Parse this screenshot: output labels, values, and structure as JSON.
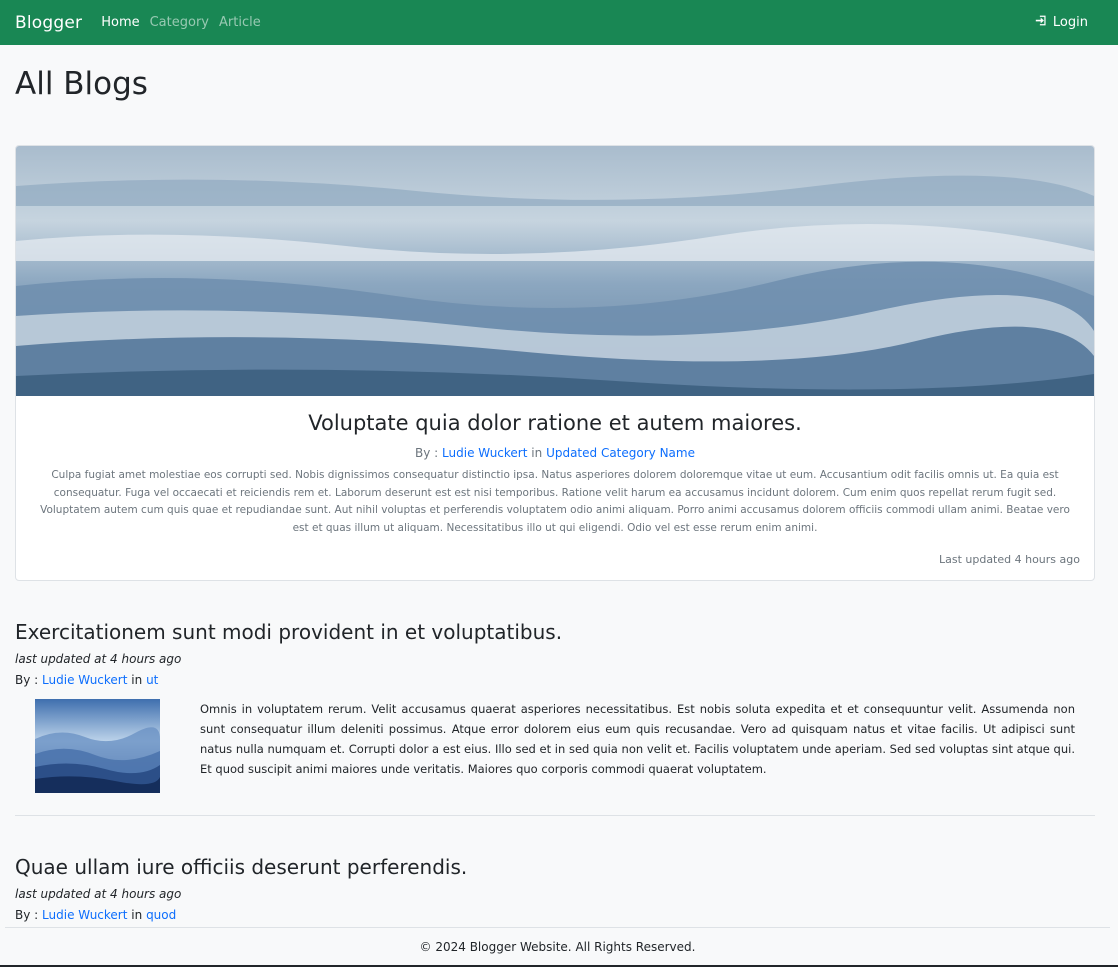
{
  "navbar": {
    "brand": "Blogger",
    "links": [
      "Home",
      "Category",
      "Article"
    ],
    "login_label": "Login",
    "bg_color": "#198754"
  },
  "page_title": "All Blogs",
  "featured": {
    "title": "Voluptate quia dolor ratione et autem maiores.",
    "by_prefix": "By :",
    "author": "Ludie Wuckert",
    "in_word": "in",
    "category": "Updated Category Name",
    "body": "Culpa fugiat amet molestiae eos corrupti sed. Nobis dignissimos consequatur distinctio ipsa. Natus asperiores dolorem doloremque vitae ut eum. Accusantium odit facilis omnis ut. Ea quia est consequatur. Fuga vel occaecati et reiciendis rem et. Laborum deserunt est est nisi temporibus. Ratione velit harum ea accusamus incidunt dolorem. Cum enim quos repellat rerum fugit sed. Voluptatem autem cum quis quae et repudiandae sunt. Aut nihil voluptas et perferendis voluptatem odio animi aliquam. Porro animi accusamus dolorem officiis commodi ullam animi. Beatae vero est et quas illum ut aliquam. Necessitatibus illo ut qui eligendi. Odio vel est esse rerum enim animi.",
    "updated": "Last updated 4 hours ago"
  },
  "posts": [
    {
      "title": "Exercitationem sunt modi provident in et voluptatibus.",
      "updated": "last updated at 4 hours ago",
      "by_prefix": "By :",
      "author": "Ludie Wuckert",
      "in_word": "in",
      "category": "ut",
      "excerpt": "Omnis in voluptatem rerum. Velit accusamus quaerat asperiores necessitatibus. Est nobis soluta expedita et et consequuntur velit. Assumenda non sunt consequatur illum deleniti possimus. Atque error dolorem eius eum quis recusandae. Vero ad quisquam natus et vitae facilis. Ut adipisci sunt natus nulla numquam et. Corrupti dolor a est eius. Illo sed et in sed quia non velit et. Facilis voluptatem unde aperiam. Sed sed voluptas sint atque qui. Et quod suscipit animi maiores unde veritatis. Maiores quo corporis commodi quaerat voluptatem."
    },
    {
      "title": "Quae ullam iure officiis deserunt perferendis.",
      "updated": "last updated at 4 hours ago",
      "by_prefix": "By :",
      "author": "Ludie Wuckert",
      "in_word": "in",
      "category": "quod"
    }
  ],
  "footer": {
    "text": "© 2024 Blogger Website. All Rights Reserved."
  }
}
